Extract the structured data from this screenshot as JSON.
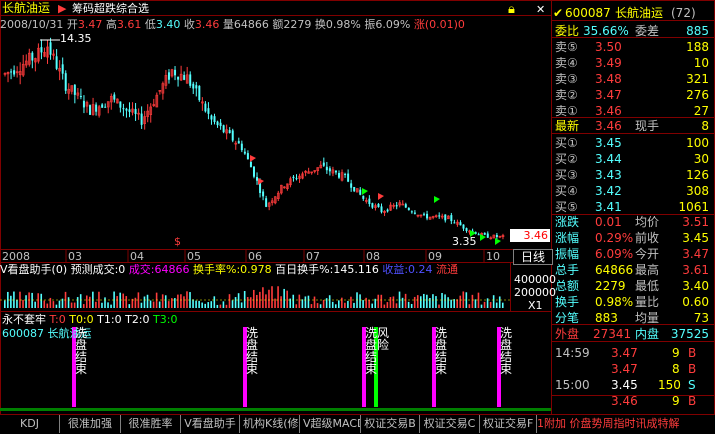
{
  "header": {
    "stock_name": "长航油运",
    "indicator_name": "筹码超跌综合选",
    "date": "2008/10/31",
    "open_label": "开",
    "open": "3.47",
    "high_label": "高",
    "high": "3.61",
    "low_label": "低",
    "low": "3.40",
    "close_label": "收",
    "close": "3.46",
    "vol_label": "量",
    "vol": "64866",
    "amount_label": "额",
    "amount": "2279",
    "turnover_label": "换",
    "turnover": "0.98%",
    "amplitude_label": "振",
    "amplitude": "6.09%",
    "change_label": "涨",
    "change": "(0.01)0"
  },
  "main_chart": {
    "high_label": "14.35",
    "low_label": "3.35",
    "current_price_tag": "3.46",
    "months": [
      "2008",
      "03",
      "04",
      "05",
      "06",
      "07",
      "08",
      "09",
      "10"
    ],
    "buy_signal_glyph": "$"
  },
  "sub1": {
    "title": "V看盘助手(0) 预测成交:0",
    "vol_label": "成交:64866",
    "turnover_label": "换手率%:0.978",
    "hundred_day_label": "百日换手%:145.116",
    "gain_label": "收益:0.24",
    "flow_label": "流通",
    "axis_top": "400000",
    "axis_mid": "200000",
    "axis_unit": "X1"
  },
  "sub2": {
    "title": "永不套牢",
    "t0": "T:0",
    "t00": "T0:0",
    "t1": "T1:0",
    "t2": "T2:0",
    "t3": "T3:0",
    "code_name": "600087 长航油运",
    "signals": [
      {
        "text": "洗盘结束",
        "color": "#ff00ff"
      },
      {
        "text": "洗盘结束",
        "color": "#ff00ff"
      },
      {
        "text": "洗盘结束",
        "color": "#ff00ff"
      },
      {
        "text": "风险",
        "color": "#00ff00"
      },
      {
        "text": "洗盘结束",
        "color": "#ff00ff"
      },
      {
        "text": "洗盘结束",
        "color": "#ff00ff"
      }
    ]
  },
  "quote": {
    "code": "600087",
    "name": "长航油运",
    "rank": "(72)",
    "weibi_label": "委比",
    "weibi": "35.66%",
    "weicha_label": "委差",
    "weicha": "885",
    "sells": [
      {
        "label": "卖⑤",
        "price": "3.50",
        "vol": "188"
      },
      {
        "label": "卖④",
        "price": "3.49",
        "vol": "10"
      },
      {
        "label": "卖③",
        "price": "3.48",
        "vol": "321"
      },
      {
        "label": "卖②",
        "price": "3.47",
        "vol": "276"
      },
      {
        "label": "卖①",
        "price": "3.46",
        "vol": "27"
      }
    ],
    "latest_label": "最新",
    "latest": "3.46",
    "current_hand_label": "现手",
    "current_hand": "8",
    "buys": [
      {
        "label": "买①",
        "price": "3.45",
        "vol": "100"
      },
      {
        "label": "买②",
        "price": "3.44",
        "vol": "30"
      },
      {
        "label": "买③",
        "price": "3.43",
        "vol": "126"
      },
      {
        "label": "买④",
        "price": "3.42",
        "vol": "308"
      },
      {
        "label": "买⑤",
        "price": "3.41",
        "vol": "1061"
      }
    ],
    "stats": [
      {
        "l1": "涨跌",
        "v1": "0.01",
        "l2": "均价",
        "v2": "3.51"
      },
      {
        "l1": "涨幅",
        "v1": "0.29%",
        "l2": "前收",
        "v2": "3.45"
      },
      {
        "l1": "振幅",
        "v1": "6.09%",
        "l2": "今开",
        "v2": "3.47"
      },
      {
        "l1": "总手",
        "v1": "64866",
        "l2": "最高",
        "v2": "3.61"
      },
      {
        "l1": "总额",
        "v1": "2279",
        "l2": "最低",
        "v2": "3.40"
      },
      {
        "l1": "换手",
        "v1": "0.98%",
        "l2": "量比",
        "v2": "0.60"
      },
      {
        "l1": "分笔",
        "v1": "883",
        "l2": "均量",
        "v2": "73"
      }
    ],
    "outer_label": "外盘",
    "outer": "27341",
    "inner_label": "内盘",
    "inner": "37525",
    "ticks": [
      {
        "time": "14:59",
        "price": "3.47",
        "vol": "9",
        "side": "B"
      },
      {
        "time": "",
        "price": "3.47",
        "vol": "8",
        "side": "B"
      },
      {
        "time": "15:00",
        "price": "3.45",
        "vol": "150",
        "side": "S"
      },
      {
        "time": "",
        "price": "3.46",
        "vol": "9",
        "side": "B"
      }
    ],
    "day_tab": "日线"
  },
  "tabs": [
    "KDJ",
    "很准加强",
    "很准胜率",
    "V看盘助手",
    "机构K线(修",
    "V超级MACD",
    "权证交易B",
    "权证交易C",
    "权证交易F"
  ],
  "status_bar_text": "1附加 价盘势周指时讯成特解",
  "colors": {
    "up": "#ff3c3c",
    "down": "#54ffff",
    "yellow": "#ffff00",
    "magenta": "#ff00ff",
    "grid": "#800000"
  }
}
